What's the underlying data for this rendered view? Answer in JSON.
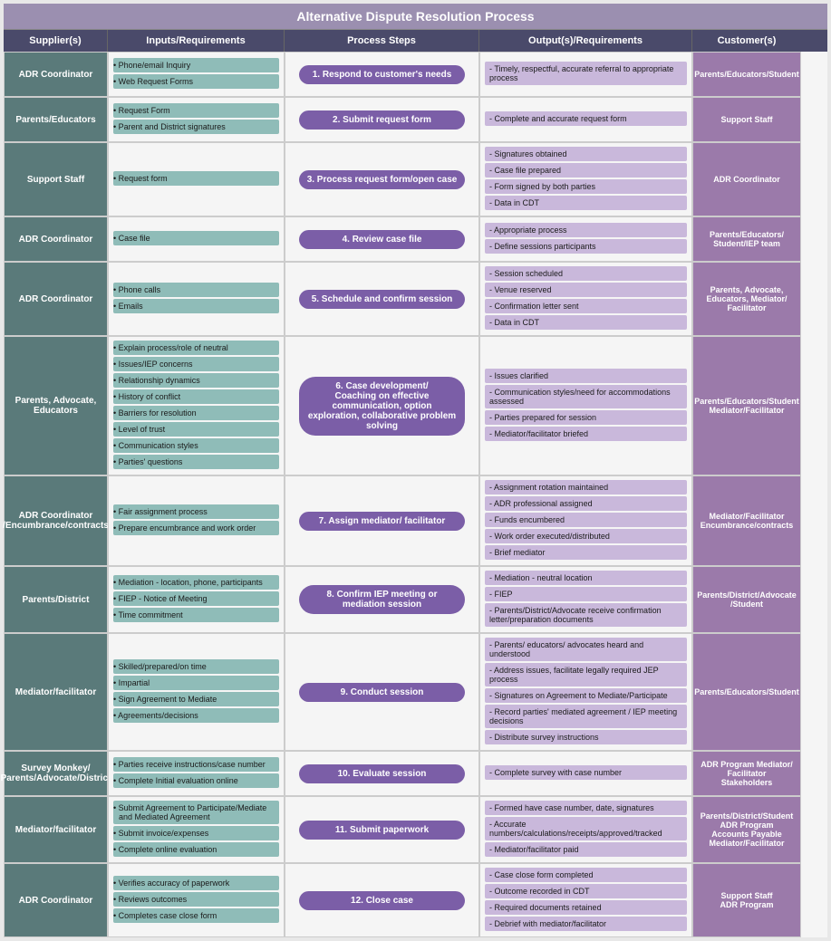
{
  "title": "Alternative Dispute Resolution Process",
  "columns": [
    "Supplier(s)",
    "Inputs/Requirements",
    "Process Steps",
    "Output(s)/Requirements",
    "Customer(s)"
  ],
  "rows": [
    {
      "supplier": "ADR Coordinator",
      "inputs": [
        "Phone/email Inquiry",
        "Web Request Forms"
      ],
      "process": "1. Respond to customer's needs",
      "outputs": [
        "Timely, respectful, accurate referral to appropriate process"
      ],
      "customer": "Parents/Educators/Student"
    },
    {
      "supplier": "Parents/Educators",
      "inputs": [
        "Request Form",
        "Parent and District signatures"
      ],
      "process": "2. Submit request form",
      "outputs": [
        "Complete and accurate request form"
      ],
      "customer": "Support Staff"
    },
    {
      "supplier": "Support Staff",
      "inputs": [
        "Request form"
      ],
      "process": "3. Process request form/open case",
      "outputs": [
        "Signatures obtained",
        "Case file prepared",
        "Form signed by both parties",
        "Data in CDT"
      ],
      "customer": "ADR Coordinator"
    },
    {
      "supplier": "ADR Coordinator",
      "inputs": [
        "Case file"
      ],
      "process": "4. Review case file",
      "outputs": [
        "Appropriate process",
        "Define sessions participants"
      ],
      "customer": "Parents/Educators/\nStudent/IEP team"
    },
    {
      "supplier": "ADR Coordinator",
      "inputs": [
        "Phone calls",
        "Emails"
      ],
      "process": "5. Schedule and confirm session",
      "outputs": [
        "Session scheduled",
        "Venue reserved",
        "Confirmation letter sent",
        "Data in CDT"
      ],
      "customer": "Parents, Advocate,\nEducators, Mediator/\nFacilitator"
    },
    {
      "supplier": "Parents, Advocate,\nEducators",
      "inputs": [
        "Explain process/role of neutral",
        "Issues/IEP concerns",
        "Relationship dynamics",
        "History of conflict",
        "Barriers for resolution",
        "Level of trust",
        "Communication styles",
        "Parties' questions"
      ],
      "process": "6. Case development/\nCoaching on effective communication, option\nexploration, collaborative problem solving",
      "outputs": [
        "Issues clarified",
        "Communication styles/need for accommodations assessed",
        "Parties prepared for session",
        "Mediator/facilitator briefed"
      ],
      "customer": "Parents/Educators/Student\nMediator/Facilitator"
    },
    {
      "supplier": "ADR Coordinator\n/Encumbrance/contracts",
      "inputs": [
        "Fair assignment process",
        "Prepare encumbrance and work order"
      ],
      "process": "7. Assign mediator/ facilitator",
      "outputs": [
        "Assignment rotation maintained",
        "ADR professional assigned",
        "Funds encumbered",
        "Work order executed/distributed",
        "Brief mediator"
      ],
      "customer": "Mediator/Facilitator\nEncumbrance/contracts"
    },
    {
      "supplier": "Parents/District",
      "inputs": [
        "Mediation - location, phone, participants",
        "FIEP - Notice of Meeting",
        "Time commitment"
      ],
      "process": "8. Confirm IEP meeting or mediation session",
      "outputs": [
        "Mediation - neutral location",
        "FIEP",
        "Parents/District/Advocate receive confirmation letter/preparation documents"
      ],
      "customer": "Parents/District/Advocate\n/Student"
    },
    {
      "supplier": "Mediator/facilitator",
      "inputs": [
        "Skilled/prepared/on time",
        "Impartial",
        "Sign Agreement to Mediate",
        "Agreements/decisions"
      ],
      "process": "9. Conduct session",
      "outputs": [
        "Parents/ educators/ advocates heard and understood",
        "Address issues, facilitate legally required JEP process",
        "Signatures on Agreement to Mediate/Participate",
        "Record parties' mediated agreement / IEP meeting decisions",
        "Distribute survey instructions"
      ],
      "customer": "Parents/Educators/Student"
    },
    {
      "supplier": "Survey Monkey/\nParents/Advocate/District",
      "inputs": [
        "Parties receive instructions/case number",
        "Complete Initial evaluation online"
      ],
      "process": "10. Evaluate session",
      "outputs": [
        "Complete survey with case number"
      ],
      "customer": "ADR Program Mediator/\nFacilitator\nStakeholders"
    },
    {
      "supplier": "Mediator/facilitator",
      "inputs": [
        "Submit Agreement to Participate/Mediate and Mediated Agreement",
        "Submit invoice/expenses",
        "Complete online evaluation"
      ],
      "process": "11. Submit paperwork",
      "outputs": [
        "Formed have case number, date, signatures",
        "Accurate numbers/calculations/receipts/approved/tracked",
        "Mediator/facilitator paid"
      ],
      "customer": "Parents/District/Student\nADR Program\nAccounts Payable\nMediator/Facilitator"
    },
    {
      "supplier": "ADR Coordinator",
      "inputs": [
        "Verifies accuracy of paperwork",
        "Reviews outcomes",
        "Completes case close form"
      ],
      "process": "12. Close case",
      "outputs": [
        "Case close form completed",
        "Outcome recorded in CDT",
        "Required documents retained",
        "Debrief with mediator/facilitator"
      ],
      "customer": "Support Staff\nADR Program"
    }
  ]
}
